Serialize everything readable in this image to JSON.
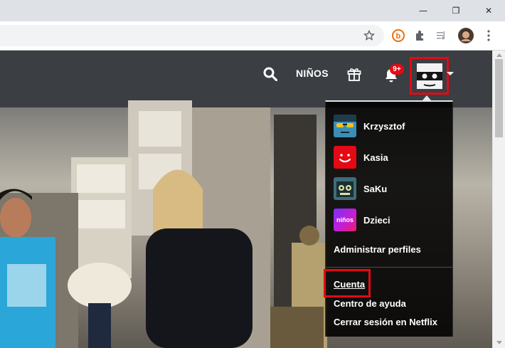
{
  "browser": {
    "window_controls": {
      "minimize": "—",
      "restore": "❐",
      "close": "✕"
    },
    "toolbar_icons": [
      "star-icon",
      "extension-b-icon",
      "puzzle-icon",
      "media-icon",
      "avatar",
      "more-icon"
    ]
  },
  "netflix": {
    "nav": {
      "kids_label": "NIÑOS",
      "notifications_badge": "9+"
    },
    "menu": {
      "profiles": [
        {
          "name": "Krzysztof",
          "avatar": "sunglasses-avatar"
        },
        {
          "name": "Kasia",
          "avatar": "red-smile-avatar"
        },
        {
          "name": "SaKu",
          "avatar": "robot-avatar"
        },
        {
          "name": "Dzieci",
          "avatar": "kids-avatar",
          "avatar_text": "niños"
        }
      ],
      "manage_profiles": "Administrar perfiles",
      "account": "Cuenta",
      "help_center": "Centro de ayuda",
      "sign_out": "Cerrar sesión en Netflix"
    },
    "colors": {
      "accent": "#e50914",
      "menu_bg": "#000000"
    }
  }
}
